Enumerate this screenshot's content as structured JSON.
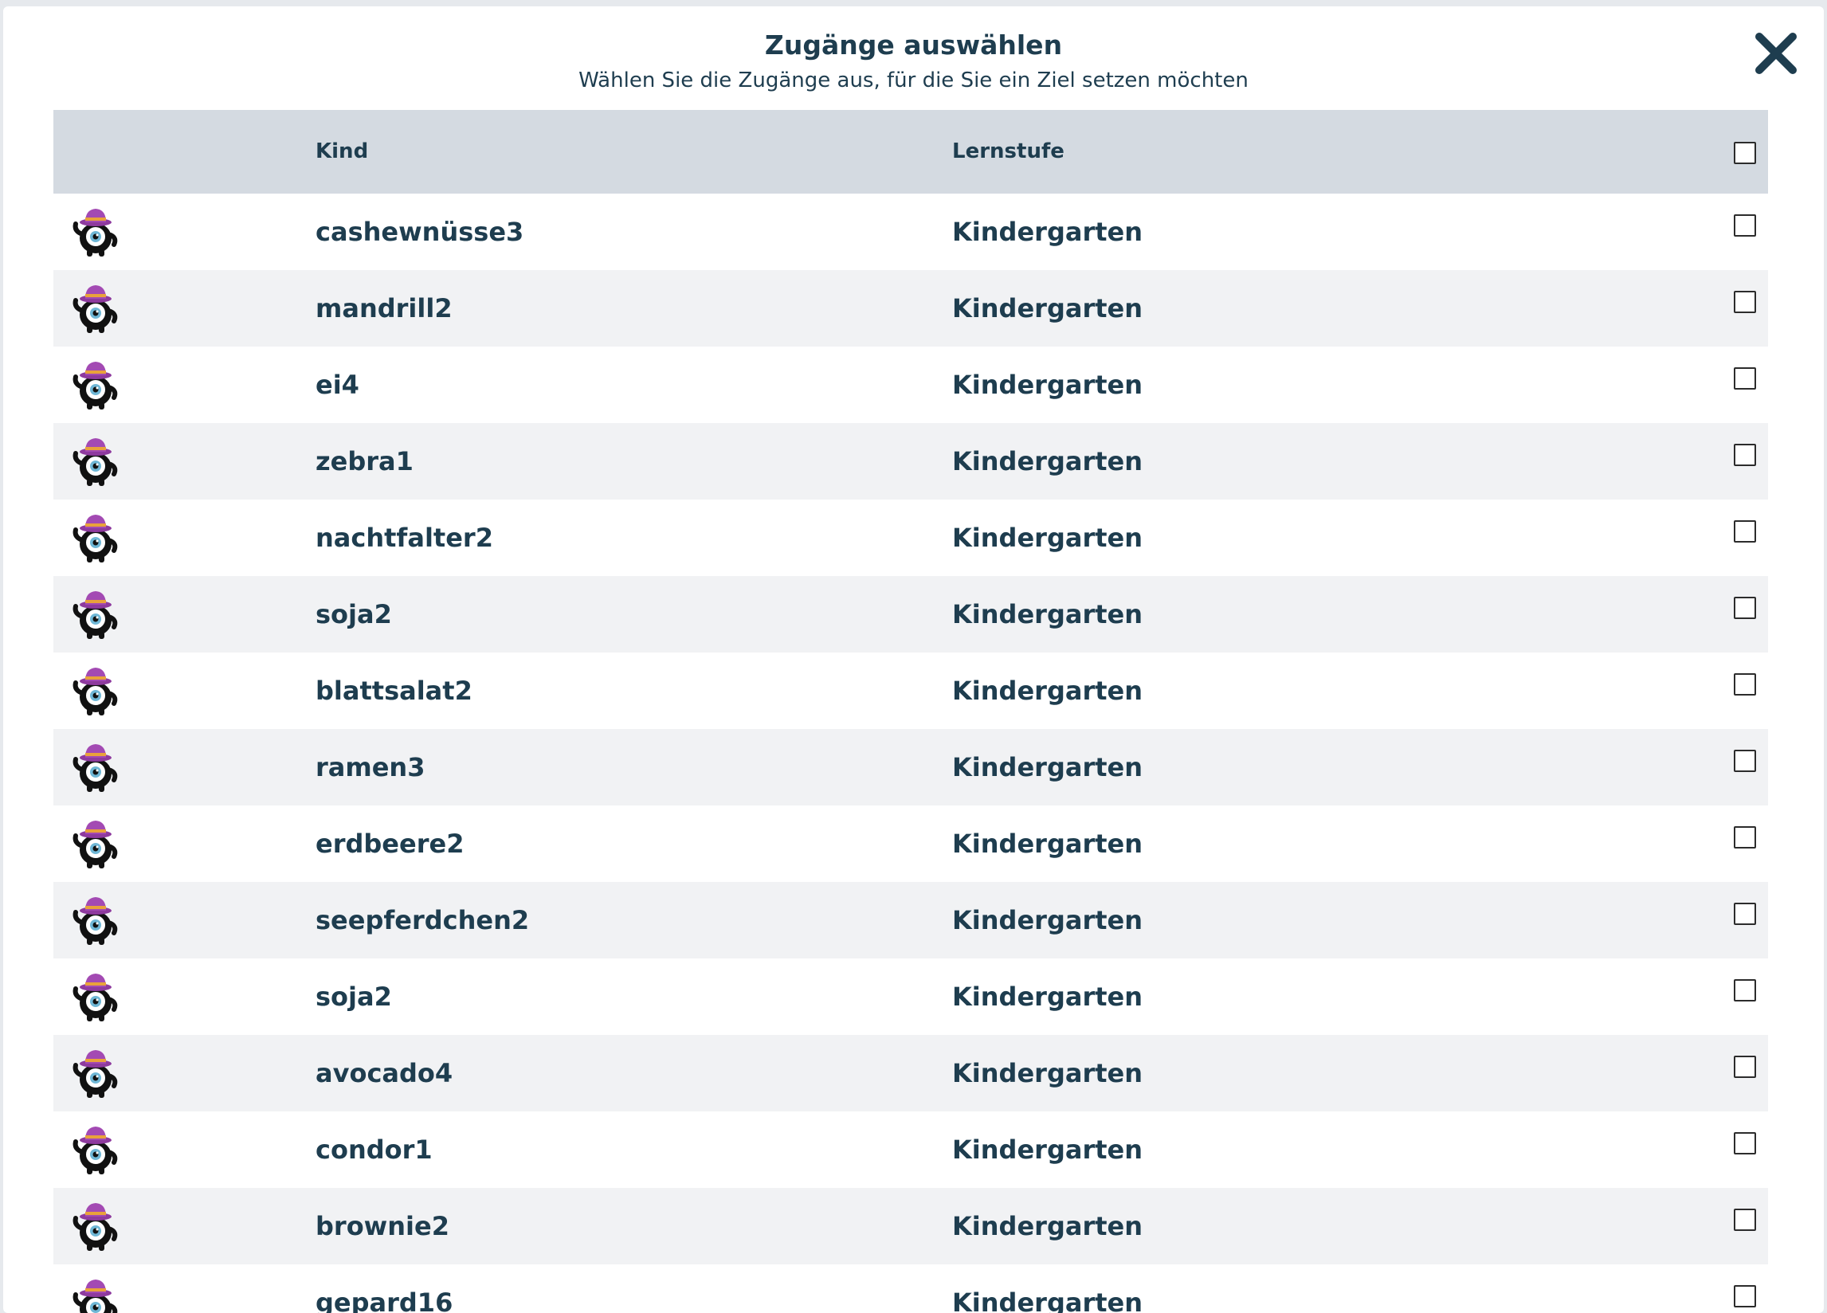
{
  "modal": {
    "title": "Zugänge auswählen",
    "subtitle": "Wählen Sie die Zugänge aus, für die Sie ein Ziel setzen möchten",
    "close_icon": "close-icon"
  },
  "table": {
    "headers": {
      "kind": "Kind",
      "level": "Lernstufe"
    },
    "select_all_checked": false,
    "rows": [
      {
        "kind": "cashewnüsse3",
        "level": "Kindergarten",
        "checked": false
      },
      {
        "kind": "mandrill2",
        "level": "Kindergarten",
        "checked": false
      },
      {
        "kind": "ei4",
        "level": "Kindergarten",
        "checked": false
      },
      {
        "kind": "zebra1",
        "level": "Kindergarten",
        "checked": false
      },
      {
        "kind": "nachtfalter2",
        "level": "Kindergarten",
        "checked": false
      },
      {
        "kind": "soja2",
        "level": "Kindergarten",
        "checked": false
      },
      {
        "kind": "blattsalat2",
        "level": "Kindergarten",
        "checked": false
      },
      {
        "kind": "ramen3",
        "level": "Kindergarten",
        "checked": false
      },
      {
        "kind": "erdbeere2",
        "level": "Kindergarten",
        "checked": false
      },
      {
        "kind": "seepferdchen2",
        "level": "Kindergarten",
        "checked": false
      },
      {
        "kind": "soja2",
        "level": "Kindergarten",
        "checked": false
      },
      {
        "kind": "avocado4",
        "level": "Kindergarten",
        "checked": false
      },
      {
        "kind": "condor1",
        "level": "Kindergarten",
        "checked": false
      },
      {
        "kind": "brownie2",
        "level": "Kindergarten",
        "checked": false
      },
      {
        "kind": "gepard16",
        "level": "Kindergarten",
        "checked": false
      }
    ]
  },
  "colors": {
    "text": "#1e3d4f",
    "header_bg": "#d4dae1",
    "row_alt_bg": "#f1f2f4",
    "avatar_hat": "#8e3a9e"
  }
}
